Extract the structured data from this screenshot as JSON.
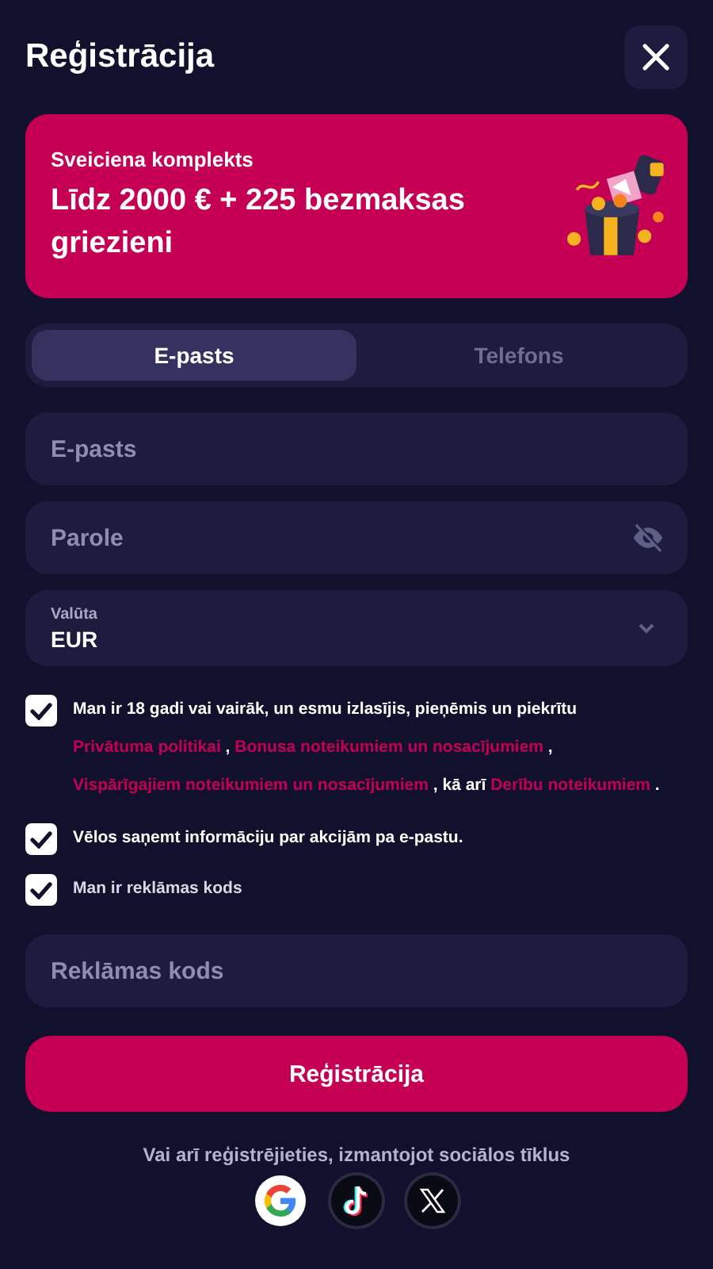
{
  "header": {
    "title": "Reģistrācija"
  },
  "promo": {
    "subtitle": "Sveiciena komplekts",
    "headline": "Līdz 2000 € + 225 bezmaksas griezieni"
  },
  "tabs": [
    {
      "label": "E-pasts",
      "selected": true
    },
    {
      "label": "Telefons",
      "selected": false
    }
  ],
  "fields": [
    {
      "kind": "text",
      "placeholder": "E-pasts"
    },
    {
      "kind": "password",
      "placeholder": "Parole"
    },
    {
      "kind": "select",
      "label": "Valūta",
      "value": "EUR"
    }
  ],
  "consents": [
    {
      "checked": true,
      "segments": [
        {
          "kind": "text",
          "text": "Man ir 18 gadi vai vairāk, un esmu izlasījis, pieņēmis un piekrītu "
        },
        {
          "kind": "link",
          "text": "Privātuma politikai"
        },
        {
          "kind": "text",
          "text": " , "
        },
        {
          "kind": "link",
          "text": "Bonusa noteikumiem un nosacījumiem"
        },
        {
          "kind": "text",
          "text": " , "
        },
        {
          "kind": "link",
          "text": "Vispārīgajiem noteikumiem un nosacījumiem"
        },
        {
          "kind": "text",
          "text": " , kā arī "
        },
        {
          "kind": "link",
          "text": "Derību noteikumiem"
        },
        {
          "kind": "text",
          "text": " ."
        }
      ]
    },
    {
      "checked": true,
      "segments": [
        {
          "kind": "text",
          "text": "Vēlos saņemt informāciju par akcijām pa e-pastu."
        }
      ]
    },
    {
      "checked": true,
      "muted": true,
      "segments": [
        {
          "kind": "text",
          "text": "Man ir reklāmas kods"
        }
      ]
    }
  ],
  "promo_code": {
    "placeholder": "Reklāmas kods"
  },
  "submit": {
    "label": "Reģistrācija"
  },
  "social": {
    "caption": "Vai arī reģistrējieties, izmantojot sociālos tīklus",
    "providers": [
      {
        "kind": "google"
      },
      {
        "kind": "tiktok"
      },
      {
        "kind": "x"
      }
    ]
  }
}
